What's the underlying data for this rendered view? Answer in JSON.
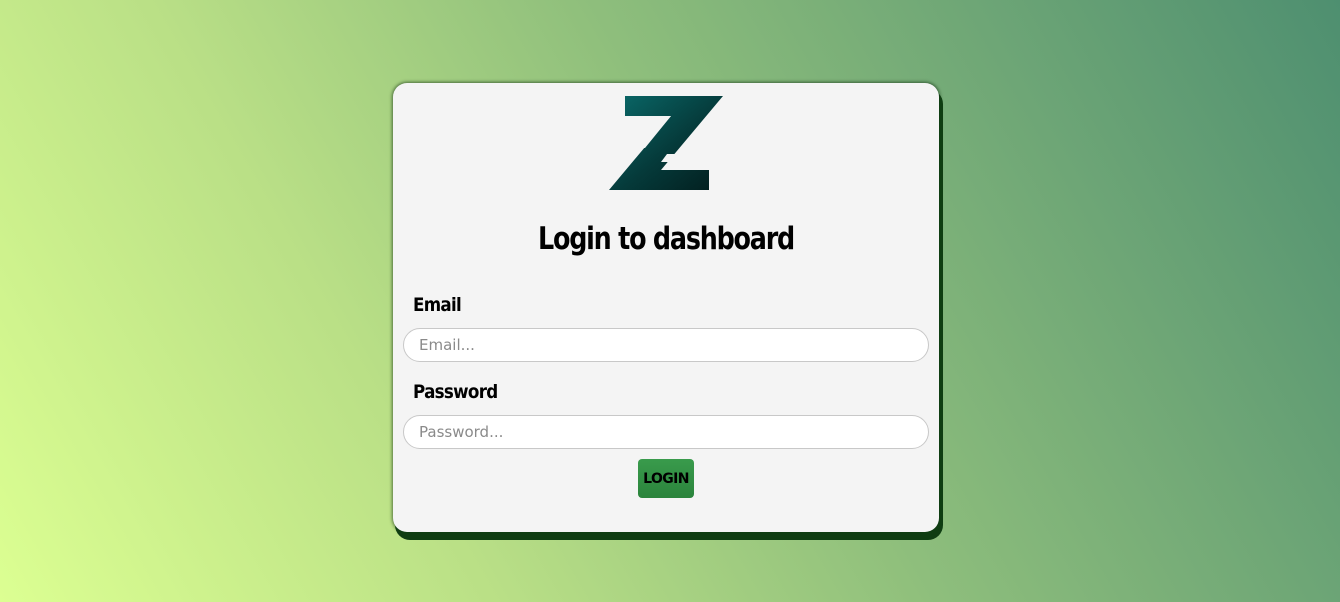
{
  "logo": {
    "icon": "z-logo-icon",
    "colors": [
      "#0a6a6a",
      "#062b2b"
    ]
  },
  "title": "Login to dashboard",
  "email": {
    "label": "Email",
    "placeholder": "Email...",
    "value": ""
  },
  "password": {
    "label": "Password",
    "placeholder": "Password...",
    "value": ""
  },
  "login_button": "LOGIN",
  "colors": {
    "card_background": "#f4f4f4",
    "button": "#2f8f42",
    "card_shadow": "#0f3d12",
    "background_start": "#dcff92",
    "background_end": "#4e8f70"
  }
}
